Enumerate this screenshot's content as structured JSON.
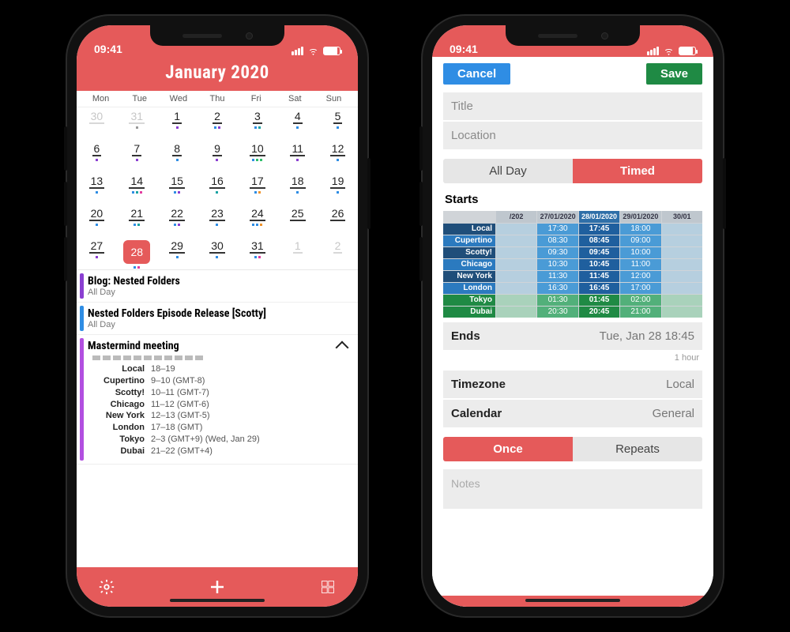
{
  "status": {
    "time": "09:41"
  },
  "calendar": {
    "title": "January 2020",
    "weekdays": [
      "Mon",
      "Tue",
      "Wed",
      "Thu",
      "Fri",
      "Sat",
      "Sun"
    ],
    "events": [
      {
        "title": "Blog: Nested Folders",
        "sub": "All Day",
        "color": "#8a3fd1"
      },
      {
        "title": "Nested Folders Episode Release [Scotty]",
        "sub": "All Day",
        "color": "#2f8de4"
      },
      {
        "title": "Mastermind meeting",
        "color": "#b24fe0",
        "timezones": [
          {
            "loc": "Local",
            "val": "18–19"
          },
          {
            "loc": "Cupertino",
            "val": "9–10 (GMT-8)"
          },
          {
            "loc": "Scotty!",
            "val": "10–11 (GMT-7)"
          },
          {
            "loc": "Chicago",
            "val": "11–12 (GMT-6)"
          },
          {
            "loc": "New York",
            "val": "12–13 (GMT-5)"
          },
          {
            "loc": "London",
            "val": "17–18 (GMT)"
          },
          {
            "loc": "Tokyo",
            "val": "2–3 (GMT+9) (Wed, Jan 29)"
          },
          {
            "loc": "Dubai",
            "val": "21–22 (GMT+4)"
          }
        ]
      }
    ]
  },
  "form": {
    "cancel": "Cancel",
    "save": "Save",
    "title_ph": "Title",
    "location_ph": "Location",
    "allday": "All Day",
    "timed": "Timed",
    "starts": "Starts",
    "ends_label": "Ends",
    "ends_value": "Tue, Jan 28 18:45",
    "duration": "1 hour",
    "timezone_label": "Timezone",
    "timezone_value": "Local",
    "calendar_label": "Calendar",
    "calendar_value": "General",
    "once": "Once",
    "repeats": "Repeats",
    "notes_ph": "Notes",
    "picker": {
      "dates": [
        "/202",
        "27/01/2020",
        "28/01/2020",
        "29/01/2020",
        "30/01"
      ],
      "rows": [
        {
          "loc": "Local",
          "cells": [
            "",
            "17:30",
            "17:45",
            "18:00",
            ""
          ]
        },
        {
          "loc": "Cupertino",
          "cells": [
            "",
            "08:30",
            "08:45",
            "09:00",
            ""
          ]
        },
        {
          "loc": "Scotty!",
          "cells": [
            "",
            "09:30",
            "09:45",
            "10:00",
            ""
          ]
        },
        {
          "loc": "Chicago",
          "cells": [
            "",
            "10:30",
            "10:45",
            "11:00",
            ""
          ]
        },
        {
          "loc": "New York",
          "cells": [
            "",
            "11:30",
            "11:45",
            "12:00",
            ""
          ]
        },
        {
          "loc": "London",
          "cells": [
            "",
            "16:30",
            "16:45",
            "17:00",
            ""
          ]
        },
        {
          "loc": "Tokyo",
          "cells": [
            "",
            "01:30",
            "01:45",
            "02:00",
            ""
          ]
        },
        {
          "loc": "Dubai",
          "cells": [
            "",
            "20:30",
            "20:45",
            "21:00",
            ""
          ]
        }
      ]
    }
  }
}
